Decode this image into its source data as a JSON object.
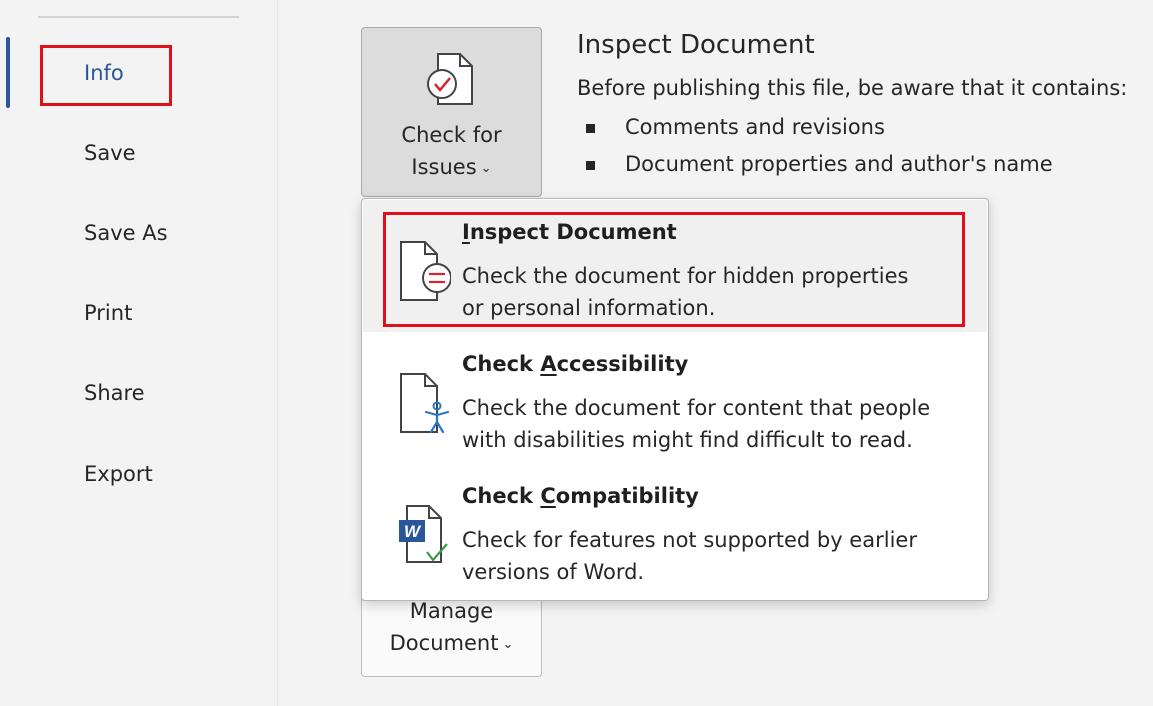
{
  "sidebar": {
    "items": [
      {
        "label": "Info",
        "active": true
      },
      {
        "label": "Save"
      },
      {
        "label": "Save As"
      },
      {
        "label": "Print"
      },
      {
        "label": "Share"
      },
      {
        "label": "Export"
      }
    ]
  },
  "check_issues_button": {
    "line1": "Check for",
    "line2": "Issues"
  },
  "manage_button": {
    "line1": "Manage",
    "line2": "Document"
  },
  "inspect_section": {
    "title": "Inspect Document",
    "description": "Before publishing this file, be aware that it contains:",
    "bullets": [
      "Comments and revisions",
      "Document properties and author's name"
    ]
  },
  "menu": {
    "items": [
      {
        "title_pre": "",
        "title_accel": "I",
        "title_post": "nspect Document",
        "desc_line1": "Check the document for hidden properties",
        "desc_line2": "or personal information."
      },
      {
        "title_pre": "Check ",
        "title_accel": "A",
        "title_post": "ccessibility",
        "desc_line1": "Check the document for content that people",
        "desc_line2": "with disabilities might find difficult to read."
      },
      {
        "title_pre": "Check ",
        "title_accel": "C",
        "title_post": "ompatibility",
        "desc_line1": "Check for features not supported by earlier",
        "desc_line2": "versions of Word."
      }
    ]
  },
  "colors": {
    "accent": "#2b579a",
    "highlight": "#e0101a"
  }
}
